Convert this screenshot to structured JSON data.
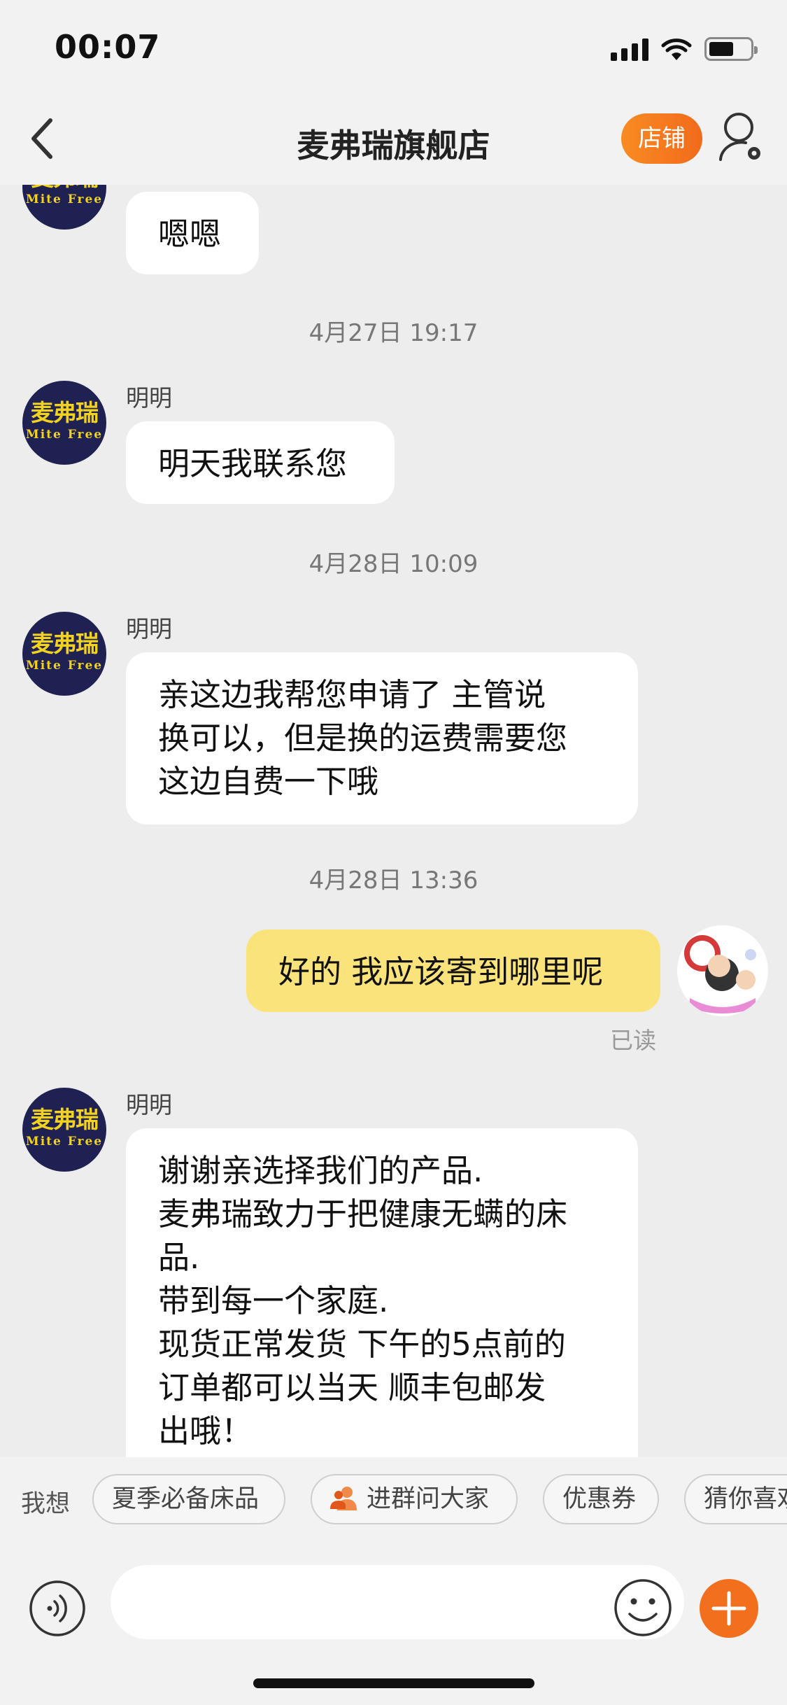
{
  "status_bar": {
    "time": "00:07"
  },
  "nav": {
    "title": "麦弗瑞旗舰店",
    "shop_button": "店铺"
  },
  "avatar_text": {
    "line1": "麦弗瑞",
    "line2": "Mite Free"
  },
  "messages": [
    {
      "type": "in",
      "text": "嗯嗯"
    },
    {
      "type": "time",
      "text": "4月27日 19:17"
    },
    {
      "type": "in",
      "sender": "明明",
      "text": "明天我联系您"
    },
    {
      "type": "time",
      "text": "4月28日 10:09"
    },
    {
      "type": "in",
      "sender": "明明",
      "lines": [
        "亲这边我帮您申请了 主管说",
        "换可以，但是换的运费需要您",
        "这边自费一下哦"
      ]
    },
    {
      "type": "time",
      "text": "4月28日 13:36"
    },
    {
      "type": "out",
      "text": "好的 我应该寄到哪里呢",
      "status": "已读"
    },
    {
      "type": "in",
      "sender": "明明",
      "lines": [
        "谢谢亲选择我们的产品.",
        "麦弗瑞致力于把健康无螨的床",
        "品.",
        "带到每一个家庭.",
        "现货正常发货 下午的5点前的",
        "订单都可以当天 顺丰包邮发",
        "出哦！"
      ]
    }
  ],
  "quick_bar": {
    "label": "我想",
    "chips": [
      "夏季必备床品",
      "进群问大家",
      "优惠券",
      "猜你喜欢"
    ]
  },
  "input": {
    "placeholder": ""
  },
  "colors": {
    "accent": "#f26f1d",
    "my_bubble": "#fbe37c",
    "avatar_bg": "#1f2152"
  }
}
